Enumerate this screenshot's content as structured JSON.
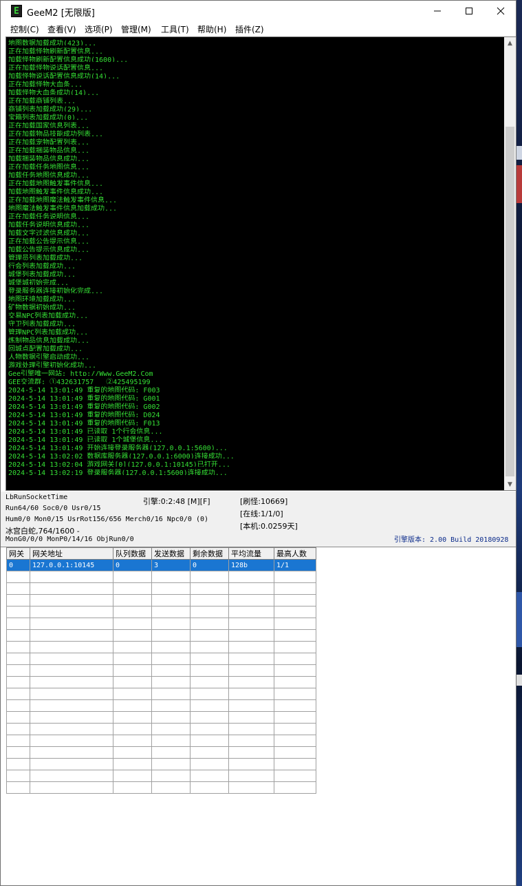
{
  "window": {
    "title": "GeeM2 [无限版]",
    "icon_letter": "E",
    "controls": [
      "minimize-icon",
      "maximize-icon",
      "close-icon"
    ]
  },
  "menu": [
    "控制(C)",
    "查看(V)",
    "选项(P)",
    "管理(M)",
    "工具(T)",
    "帮助(H)",
    "插件(Z)"
  ],
  "console": {
    "text_color": "#35e035",
    "lines": [
      "地图数据加载成功(423)...",
      "正在加载怪物刷新配置信息...",
      "加载怪物刷新配置信息成功(1600)...",
      "正在加载怪物说话配置信息...",
      "加载怪物说话配置信息成功(14)...",
      "正在加载怪物大血条...",
      "加载怪物大血条成功(14)...",
      "正在加载商铺列表...",
      "商铺列表加载成功(29)...",
      "宝箱列表加载成功(0)...",
      "正在加载国家信息列表...",
      "正在加载物品技能成功列表...",
      "正在加载宠物配置列表...",
      "正在加载捆装物品信息...",
      "加载捆装物品信息成功...",
      "正在加载任务地图信息...",
      "加载任务地图信息成功...",
      "正在加载地图触发事件信息...",
      "加载地图触发事件信息成功...",
      "正在加载地图魔法触发事件信息...",
      "地图魔法触发事件信息加载成功...",
      "正在加载任务说明信息...",
      "加载任务说明信息成功...",
      "加载文字过滤信息成功...",
      "正在加载公告提示信息...",
      "加载公告提示信息成功...",
      "管理员列表加载成功...",
      "行会列表加载成功...",
      "城堡列表加载成功...",
      "城堡城初始完成...",
      "登录服务器连接初始化完成...",
      "地图环境加载成功...",
      "矿物数据初始成功...",
      "交易NPC列表加载成功...",
      "守卫列表加载成功...",
      "管理NPC列表加载成功...",
      "炼制物品信息加载成功...",
      "回城点配置加载成功...",
      "人物数据引擎启动成功...",
      "游戏处理引擎初始化成功...",
      "Gee引擎唯一网站: http://Www.GeeM2.Com",
      "GEE交流群: ①432631757   ②425495199",
      "2024-5-14 13:01:49 重复的地图代码: F003",
      "2024-5-14 13:01:49 重复的地图代码: G001",
      "2024-5-14 13:01:49 重复的地图代码: G002",
      "2024-5-14 13:01:49 重复的地图代码: D024",
      "2024-5-14 13:01:49 重复的地图代码: F013",
      "2024-5-14 13:01:49 已读取 1个行会信息...",
      "2024-5-14 13:01:49 已读取 1个城堡信息...",
      "2024-5-14 13:01:49 开始连接登录服务器(127.0.0.1:5600)...",
      "2024-5-14 13:02:02 数据库服务器(127.0.0.1:6000)连接成功...",
      "2024-5-14 13:02:04 游戏网关[0](127.0.0.1:10145)已打开...",
      "2024-5-14 13:02:19 登录服务器(127.0.0.1:5600)连接成功..."
    ]
  },
  "status": {
    "socket_time": "LbRunSocketTime",
    "run_line": "Run64/60 Soc0/0 Usr0/15",
    "hum_line": "Hum0/0 Mon0/15 UsrRot156/656 Merch0/16 Npc0/0 (0)",
    "mob_line": "冰宫白蛇,764/1600 -",
    "mon_line": "MonG0/0/0 MonP0/14/16 ObjRun0/0",
    "engine_time": "引擎:0:2:48 [M][F]",
    "refresh": "[刷怪:10669]",
    "online": "[在线:1/1/0]",
    "local": "[本机:0.0259天]",
    "version": "引擎版本: 2.00 Build 20180928"
  },
  "gateway_table": {
    "columns": [
      "网关",
      "网关地址",
      "队列数据",
      "发送数据",
      "剩余数据",
      "平均流量",
      "最高人数"
    ],
    "rows": [
      [
        "0",
        "127.0.0.1:10145",
        "0",
        "3",
        "0",
        "128b",
        "1/1"
      ]
    ],
    "empty_rows": 19
  }
}
